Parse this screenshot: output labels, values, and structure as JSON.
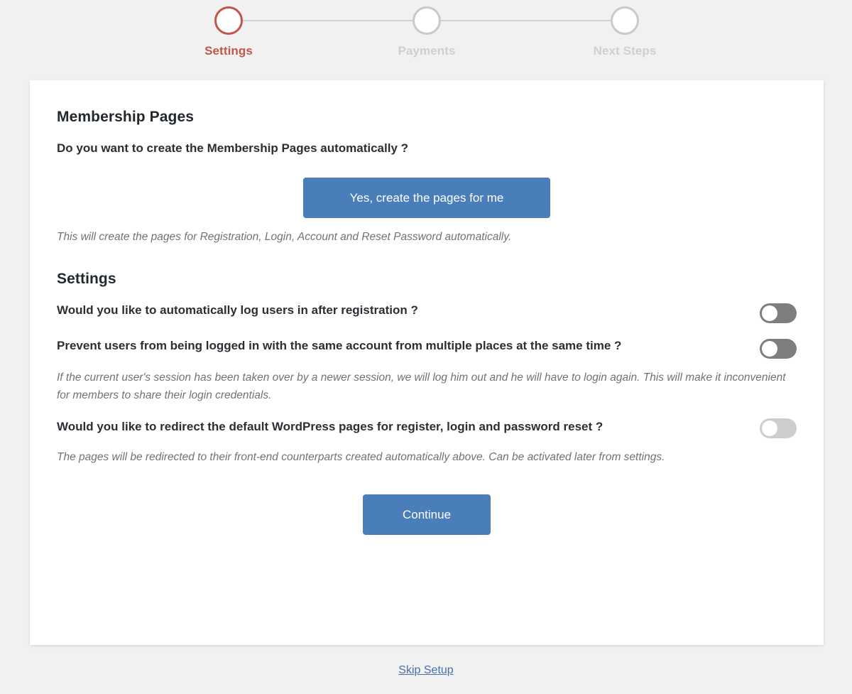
{
  "stepper": {
    "steps": [
      {
        "label": "Settings",
        "state": "active"
      },
      {
        "label": "Payments",
        "state": "inactive"
      },
      {
        "label": "Next Steps",
        "state": "inactive"
      }
    ],
    "active_color": "#c1574a",
    "inactive_color": "#cfcfcf"
  },
  "membership_pages": {
    "title": "Membership Pages",
    "question": "Do you want to create the Membership Pages automatically ?",
    "create_button": "Yes, create the pages for me",
    "helper": "This will create the pages for Registration, Login, Account and Reset Password automatically."
  },
  "settings": {
    "title": "Settings",
    "rows": [
      {
        "question": "Would you like to automatically log users in after registration ?",
        "helper": "",
        "toggle": {
          "state": "off",
          "style": "dark"
        }
      },
      {
        "question": "Prevent users from being logged in with the same account from multiple places at the same time ?",
        "helper": "If the current user's session has been taken over by a newer session, we will log him out and he will have to login again. This will make it inconvenient for members to share their login credentials.",
        "toggle": {
          "state": "off",
          "style": "dark"
        }
      },
      {
        "question": "Would you like to redirect the default WordPress pages for register, login and password reset ?",
        "helper": "The pages will be redirected to their front-end counterparts created automatically above. Can be activated later from settings.",
        "toggle": {
          "state": "off",
          "style": "light"
        }
      }
    ]
  },
  "footer": {
    "continue_button": "Continue",
    "skip_link": "Skip Setup"
  },
  "colors": {
    "page_background": "#f1f1f1",
    "card_background": "#ffffff",
    "primary_button": "#4a7ebb",
    "accent": "#c1574a",
    "link": "#4a6fa8"
  }
}
